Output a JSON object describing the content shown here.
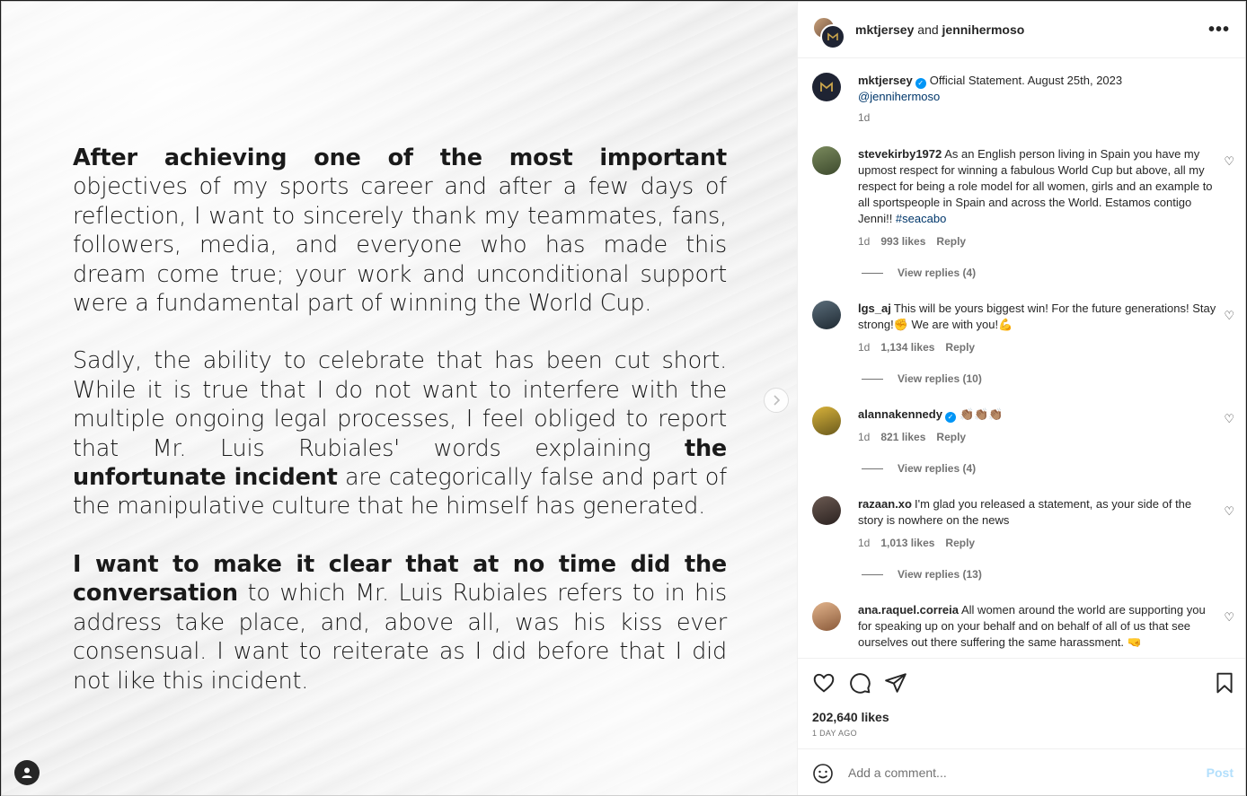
{
  "statement": {
    "p1_bold": "After achieving one of the most important",
    "p1_rest": " objectives of my sports career and after a few days of reflection, I want to sincerely thank my teammates, fans, followers, media, and ev­eryone who has made this dream come true; your work and unconditional support were a fundamental part of winning the World Cup.",
    "p2_a": "Sadly, the ability to celebrate that has been cut short. While it is true that I do not want to interfere with the multiple ongoing legal processes, I feel obliged to report that Mr. Luis Rubiales' words explaining ",
    "p2_bold": "the unfortunate incident",
    "p2_b": " are categorical­ly false and part of the manipulative culture that he himself has generated.",
    "p3_bold": "I want to make it clear that at no time did the conversa­tion",
    "p3_rest": " to which Mr. Luis Rubiales refers to in his address take place, and, above all, was his kiss ever consensual. I want to reiterate as I did before that I did not like this incident."
  },
  "header": {
    "user1": "mktjersey",
    "and": " and ",
    "user2": "jennihermoso",
    "more": "•••"
  },
  "caption": {
    "user": "mktjersey",
    "text": "Official Statement. August 25th, 2023",
    "mention": "@jennihermoso",
    "time": "1d"
  },
  "comments": [
    {
      "user": "stevekirby1972",
      "text": "As an English person living in Spain you have my upmost respect for winning a fabulous World Cup but above, all my respect for being a role model for all women, girls and an example to all sportspeople in Spain and across the World. Estamos contigo Jenni!! ",
      "hashtag": "#seacabo",
      "time": "1d",
      "likes": "993 likes",
      "reply": "Reply",
      "replies": "View replies (4)"
    },
    {
      "user": "lgs_aj",
      "text": "This will be yours biggest win! For the future generations! Stay strong!✊ We are with you!💪",
      "time": "1d",
      "likes": "1,134 likes",
      "reply": "Reply",
      "replies": "View replies (10)"
    },
    {
      "user": "alannakennedy",
      "text": "👏🏽👏🏽👏🏽",
      "time": "1d",
      "likes": "821 likes",
      "reply": "Reply",
      "replies": "View replies (4)"
    },
    {
      "user": "razaan.xo",
      "text": "I'm glad you released a statement, as your side of the story is nowhere on the news",
      "time": "1d",
      "likes": "1,013 likes",
      "reply": "Reply",
      "replies": "View replies (13)"
    },
    {
      "user": "ana.raquel.correia",
      "text": "All women around the world are supporting you for speaking up on your behalf and on behalf of all of us that see ourselves out there suffering the same harassment. 🤜"
    }
  ],
  "footer": {
    "likes": "202,640 likes",
    "ago": "1 DAY AGO",
    "placeholder": "Add a comment...",
    "post": "Post"
  },
  "icons": [
    "heart-icon",
    "comment-icon",
    "share-icon",
    "bookmark-icon",
    "emoji-icon",
    "more-icon",
    "user-tag-icon",
    "chevron-right-icon",
    "verified-icon"
  ]
}
